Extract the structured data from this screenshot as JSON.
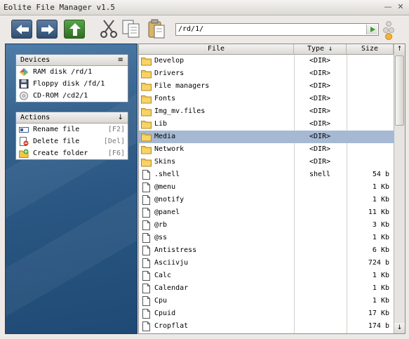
{
  "window": {
    "title": "Eolite File Manager v1.5",
    "controls": {
      "minimize": "—",
      "close": "✕"
    }
  },
  "toolbar": {
    "address": "/rd/1/",
    "buttons": [
      "back-icon",
      "forward-icon",
      "up-icon",
      "cut-icon",
      "copy-icon",
      "paste-icon"
    ]
  },
  "devices": {
    "header": "Devices",
    "control": "≡",
    "items": [
      {
        "label": "RAM disk /rd/1",
        "icon": "ram-disk-icon"
      },
      {
        "label": "Floppy disk /fd/1",
        "icon": "floppy-icon"
      },
      {
        "label": "CD-ROM /cd2/1",
        "icon": "cdrom-icon"
      }
    ]
  },
  "actions": {
    "header": "Actions",
    "control": "↓",
    "items": [
      {
        "label": "Rename file",
        "key": "[F2]",
        "icon": "rename-icon"
      },
      {
        "label": "Delete file",
        "key": "[Del]",
        "icon": "delete-icon"
      },
      {
        "label": "Create folder",
        "key": "[F6]",
        "icon": "new-folder-icon"
      }
    ]
  },
  "list": {
    "columns": {
      "file": "File",
      "type": "Type ↓",
      "size": "Size"
    },
    "scroll_up": "↑",
    "scroll_down": "↓",
    "selected": "Media",
    "rows": [
      {
        "name": "Develop",
        "type": "<DIR>",
        "size": "",
        "kind": "folder"
      },
      {
        "name": "Drivers",
        "type": "<DIR>",
        "size": "",
        "kind": "folder"
      },
      {
        "name": "File managers",
        "type": "<DIR>",
        "size": "",
        "kind": "folder"
      },
      {
        "name": "Fonts",
        "type": "<DIR>",
        "size": "",
        "kind": "folder"
      },
      {
        "name": "Img_mv.files",
        "type": "<DIR>",
        "size": "",
        "kind": "folder"
      },
      {
        "name": "Lib",
        "type": "<DIR>",
        "size": "",
        "kind": "folder"
      },
      {
        "name": "Media",
        "type": "<DIR>",
        "size": "",
        "kind": "folder"
      },
      {
        "name": "Network",
        "type": "<DIR>",
        "size": "",
        "kind": "folder"
      },
      {
        "name": "Skins",
        "type": "<DIR>",
        "size": "",
        "kind": "folder"
      },
      {
        "name": ".shell",
        "type": "shell",
        "size": "54 b",
        "kind": "file"
      },
      {
        "name": "@menu",
        "type": "",
        "size": "1 Kb",
        "kind": "file"
      },
      {
        "name": "@notify",
        "type": "",
        "size": "1 Kb",
        "kind": "file"
      },
      {
        "name": "@panel",
        "type": "",
        "size": "11 Kb",
        "kind": "file"
      },
      {
        "name": "@rb",
        "type": "",
        "size": "3 Kb",
        "kind": "file"
      },
      {
        "name": "@ss",
        "type": "",
        "size": "1 Kb",
        "kind": "file"
      },
      {
        "name": "Antistress",
        "type": "",
        "size": "6 Kb",
        "kind": "file"
      },
      {
        "name": "Asciivju",
        "type": "",
        "size": "724 b",
        "kind": "file"
      },
      {
        "name": "Calc",
        "type": "",
        "size": "1 Kb",
        "kind": "file"
      },
      {
        "name": "Calendar",
        "type": "",
        "size": "1 Kb",
        "kind": "file"
      },
      {
        "name": "Cpu",
        "type": "",
        "size": "1 Kb",
        "kind": "file"
      },
      {
        "name": "Cpuid",
        "type": "",
        "size": "17 Kb",
        "kind": "file"
      },
      {
        "name": "Cropflat",
        "type": "",
        "size": "174 b",
        "kind": "file"
      }
    ]
  },
  "colors": {
    "selection": "#a5b9d2",
    "sidebar": "#2b5985",
    "folder": "#f3c54a"
  }
}
